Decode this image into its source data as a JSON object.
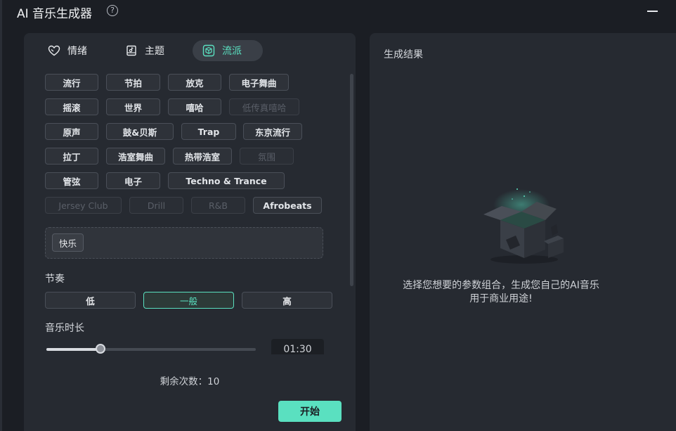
{
  "window": {
    "title": "AI 音乐生成器",
    "help_icon": "question-circle-icon",
    "minimize_icon": "minimize-icon"
  },
  "tabs": [
    {
      "label": "情绪",
      "icon": "heart-icon",
      "active": false
    },
    {
      "label": "主题",
      "icon": "book-music-icon",
      "active": false
    },
    {
      "label": "流派",
      "icon": "cube-icon",
      "active": true
    }
  ],
  "genres": [
    {
      "label": "流行",
      "enabled": true
    },
    {
      "label": "节拍",
      "enabled": true
    },
    {
      "label": "放克",
      "enabled": true
    },
    {
      "label": "电子舞曲",
      "enabled": true
    },
    {
      "label": "摇滚",
      "enabled": true
    },
    {
      "label": "世界",
      "enabled": true
    },
    {
      "label": "嘻哈",
      "enabled": true
    },
    {
      "label": "低传真嘻哈",
      "enabled": false
    },
    {
      "label": "原声",
      "enabled": true
    },
    {
      "label": "鼓&贝斯",
      "enabled": true
    },
    {
      "label": "Trap",
      "enabled": true
    },
    {
      "label": "东京流行",
      "enabled": true
    },
    {
      "label": "拉丁",
      "enabled": true
    },
    {
      "label": "浩室舞曲",
      "enabled": true
    },
    {
      "label": "热带浩室",
      "enabled": true
    },
    {
      "label": "氛围",
      "enabled": false
    },
    {
      "label": "管弦",
      "enabled": true
    },
    {
      "label": "电子",
      "enabled": true
    },
    {
      "label": "Techno & Trance",
      "enabled": true
    },
    {
      "label": "Jersey Club",
      "enabled": false
    },
    {
      "label": "Drill",
      "enabled": false
    },
    {
      "label": "R&B",
      "enabled": false
    },
    {
      "label": "Afrobeats",
      "enabled": true
    }
  ],
  "selected": {
    "chips": [
      "快乐"
    ]
  },
  "tempo": {
    "label": "节奏",
    "options": [
      "低",
      "一般",
      "高"
    ],
    "selected": "一般"
  },
  "duration": {
    "label": "音乐时长",
    "value": "01:30",
    "slider_fraction": 0.26
  },
  "remaining": {
    "text": "剩余次数：10"
  },
  "start_label": "开始",
  "result": {
    "title": "生成结果",
    "message_line1": "选择您想要的参数组合，生成您自己的AI音乐",
    "message_line2": "用于商业用途!",
    "illustration_icon": "open-box-icon"
  },
  "colors": {
    "accent": "#5ae0c0",
    "background": "#1b1e24",
    "panel": "#262a31"
  }
}
